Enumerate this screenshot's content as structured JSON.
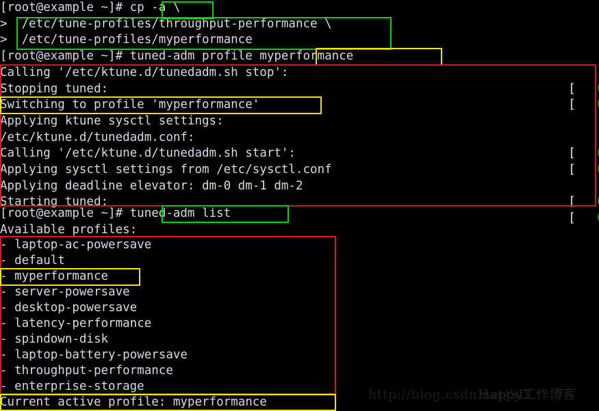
{
  "terminal": {
    "prompt": "[root@example ~]# ",
    "continuation": "> ",
    "lines": [
      {
        "id": "l0",
        "text": "[root@example ~]# cp -a \\"
      },
      {
        "id": "l1",
        "text": ">  /etc/tune-profiles/throughput-performance \\"
      },
      {
        "id": "l2",
        "text": ">  /etc/tune-profiles/myperformance"
      },
      {
        "id": "l3",
        "text": "[root@example ~]# tuned-adm profile myperformance"
      },
      {
        "id": "l4",
        "text": "Calling '/etc/ktune.d/tunedadm.sh stop':"
      },
      {
        "id": "l5",
        "text": "Stopping tuned:"
      },
      {
        "id": "l6",
        "text": "Switching to profile 'myperformance'"
      },
      {
        "id": "l7",
        "text": "Applying ktune sysctl settings:"
      },
      {
        "id": "l8",
        "text": "/etc/ktune.d/tunedadm.conf:"
      },
      {
        "id": "l9",
        "text": "Calling '/etc/ktune.d/tunedadm.sh start':"
      },
      {
        "id": "l10",
        "text": "Applying sysctl settings from /etc/sysctl.conf"
      },
      {
        "id": "l11",
        "text": "Applying deadline elevator: dm-0 dm-1 dm-2"
      },
      {
        "id": "l12",
        "text": "Starting tuned:"
      },
      {
        "id": "l13",
        "text": "[root@example ~]# tuned-adm list"
      },
      {
        "id": "l14",
        "text": "Available profiles:"
      },
      {
        "id": "l15",
        "text": "- laptop-ac-powersave"
      },
      {
        "id": "l16",
        "text": "- default"
      },
      {
        "id": "l17",
        "text": "- myperformance"
      },
      {
        "id": "l18",
        "text": "- server-powersave"
      },
      {
        "id": "l19",
        "text": "- desktop-powersave"
      },
      {
        "id": "l20",
        "text": "- latency-performance"
      },
      {
        "id": "l21",
        "text": "- spindown-disk"
      },
      {
        "id": "l22",
        "text": "- laptop-battery-powersave"
      },
      {
        "id": "l23",
        "text": "- throughput-performance"
      },
      {
        "id": "l24",
        "text": "- enterprise-storage"
      },
      {
        "id": "l25",
        "text": "Current active profile: myperformance"
      }
    ],
    "status_open": "[",
    "status_close": "]",
    "status_ok": "OK",
    "statuses": [
      {
        "id": "s0",
        "label": "OK"
      },
      {
        "id": "s1",
        "label": "OK"
      },
      {
        "id": "s2",
        "label": "OK"
      },
      {
        "id": "s3",
        "label": "OK"
      },
      {
        "id": "s4",
        "label": "OK"
      },
      {
        "id": "s5",
        "label": "OK"
      }
    ],
    "commands": {
      "copy_command": "cp -a",
      "source_profile": "/etc/tune-profiles/throughput-performance",
      "target_profile": "/etc/tune-profiles/myperformance",
      "apply_command": "tuned-adm profile",
      "applied_profile": "myperformance",
      "list_command": "tuned-adm list",
      "active_profile": "myperformance"
    },
    "colors": {
      "background": "#000000",
      "foreground": "#d6dbe4",
      "ok_green": "#1ea81e",
      "highlight_green": "#00d900",
      "highlight_yellow": "#f2e400",
      "highlight_red": "#d41b1b",
      "watermark": "#1d1d1d"
    }
  },
  "watermark": {
    "url_text": "http://blog.csdn.net/SD",
    "overlay_text": "Happy工作博客"
  }
}
